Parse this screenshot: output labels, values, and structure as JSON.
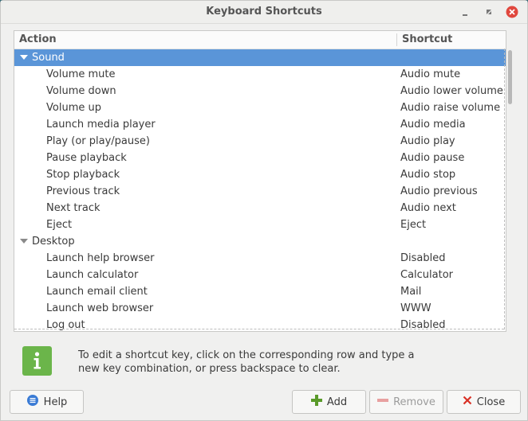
{
  "window": {
    "title": "Keyboard Shortcuts"
  },
  "tree": {
    "columns": [
      "Action",
      "Shortcut"
    ],
    "groups": [
      {
        "label": "Sound",
        "items": [
          {
            "action": "Volume mute",
            "shortcut": "Audio mute"
          },
          {
            "action": "Volume down",
            "shortcut": "Audio lower volume"
          },
          {
            "action": "Volume up",
            "shortcut": "Audio raise volume"
          },
          {
            "action": "Launch media player",
            "shortcut": "Audio media"
          },
          {
            "action": "Play (or play/pause)",
            "shortcut": "Audio play"
          },
          {
            "action": "Pause playback",
            "shortcut": "Audio pause"
          },
          {
            "action": "Stop playback",
            "shortcut": "Audio stop"
          },
          {
            "action": "Previous track",
            "shortcut": "Audio previous"
          },
          {
            "action": "Next track",
            "shortcut": "Audio next"
          },
          {
            "action": "Eject",
            "shortcut": "Eject"
          }
        ]
      },
      {
        "label": "Desktop",
        "items": [
          {
            "action": "Launch help browser",
            "shortcut": "Disabled"
          },
          {
            "action": "Launch calculator",
            "shortcut": "Calculator"
          },
          {
            "action": "Launch email client",
            "shortcut": "Mail"
          },
          {
            "action": "Launch web browser",
            "shortcut": "WWW"
          },
          {
            "action": "Log out",
            "shortcut": "Disabled"
          }
        ]
      }
    ]
  },
  "info": {
    "icon": "info-icon",
    "line1": "To edit a shortcut key, click on the corresponding row and type a",
    "line2": "new key combination, or press backspace to clear."
  },
  "buttons": {
    "help": "Help",
    "add": "Add",
    "remove": "Remove",
    "close": "Close"
  },
  "colors": {
    "selection": "#5a95d8",
    "info_green": "#6bb54a",
    "close_red": "#d93025",
    "add_green": "#5a9a2a",
    "help_blue": "#3a7bd5"
  }
}
